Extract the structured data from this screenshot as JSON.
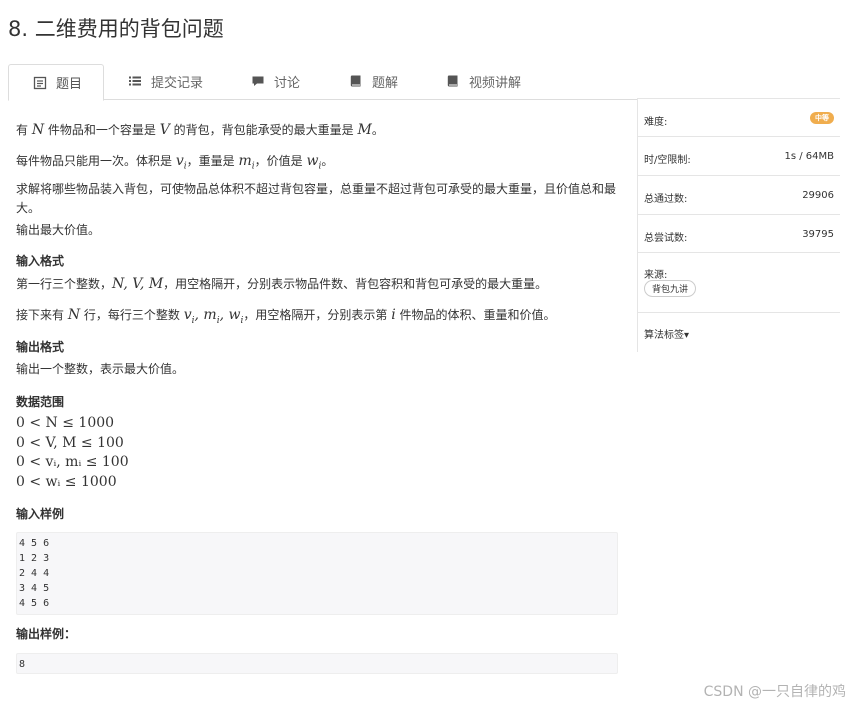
{
  "page": {
    "title": "8. 二维费用的背包问题"
  },
  "tabs": [
    {
      "label": "题目",
      "icon": "document-icon",
      "active": true
    },
    {
      "label": "提交记录",
      "icon": "list-icon",
      "active": false
    },
    {
      "label": "讨论",
      "icon": "comment-icon",
      "active": false
    },
    {
      "label": "题解",
      "icon": "book-icon",
      "active": false
    },
    {
      "label": "视频讲解",
      "icon": "video-book-icon",
      "active": false
    }
  ],
  "problem": {
    "p1_pre": "有 ",
    "p1_N": "N",
    "p1_mid": " 件物品和一个容量是 ",
    "p1_V": "V",
    "p1_mid2": " 的背包，背包能承受的最大重量是 ",
    "p1_M": "M",
    "p1_end": "。",
    "p2_pre": "每件物品只能用一次。体积是 ",
    "p2_v": "v",
    "p2_mid": "，重量是 ",
    "p2_m": "m",
    "p2_mid2": "，价值是 ",
    "p2_w": "w",
    "p2_sub": "i",
    "p2_end": "。",
    "p3": "求解将哪些物品装入背包，可使物品总体积不超过背包容量，总重量不超过背包可承受的最大重量，且价值总和最大。",
    "p4": "输出最大价值。",
    "input_heading": "输入格式",
    "in1_pre": "第一行三个整数，",
    "in1_math": "N, V, M",
    "in1_end": "，用空格隔开，分别表示物品件数、背包容积和背包可承受的最大重量。",
    "in2_pre": "接下来有 ",
    "in2_N": "N",
    "in2_mid": " 行，每行三个整数 ",
    "in2_math": "v",
    "in2_mid2": "，用空格隔开，分别表示第 ",
    "in2_i": "i",
    "in2_end": " 件物品的体积、重量和价值。",
    "output_heading": "输出格式",
    "out1": "输出一个整数，表示最大价值。",
    "range_heading": "数据范围",
    "range_lines": [
      "0 < N ≤ 1000",
      "0 < V, M ≤ 100",
      "0 < vᵢ, mᵢ ≤ 100",
      "0 < wᵢ ≤ 1000"
    ],
    "sample_in_heading": "输入样例",
    "sample_in": "4 5 6\n1 2 3\n2 4 4\n3 4 5\n4 5 6",
    "sample_out_heading": "输出样例：",
    "sample_out": "8"
  },
  "sidebar": {
    "difficulty_label": "难度:",
    "difficulty_value": "中等",
    "limit_label": "时/空限制:",
    "limit_value": "1s / 64MB",
    "passed_label": "总通过数:",
    "passed_value": "29906",
    "attempts_label": "总尝试数:",
    "attempts_value": "39795",
    "source_label": "来源:",
    "source_tag": "背包九讲",
    "tags_label": "算法标签▾"
  },
  "watermark": "CSDN @一只自律的鸡",
  "colors": {
    "badge": "#f0ad4e",
    "border": "#dddddd",
    "code_bg": "#f7f7f9"
  }
}
